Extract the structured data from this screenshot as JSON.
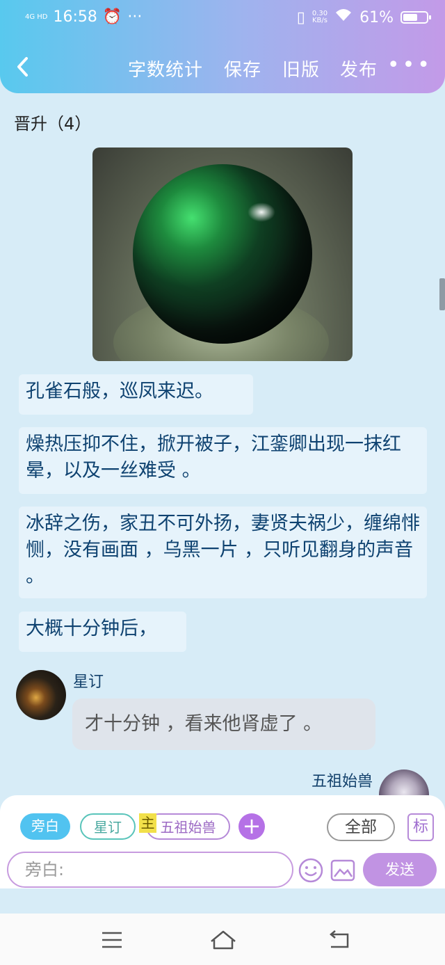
{
  "status_bar": {
    "network": "4G HD",
    "time": "16:58",
    "alarm_icon": "alarm-icon",
    "more_dots": "···",
    "speed_value": "0.30",
    "speed_unit": "KB/s",
    "battery": "61%"
  },
  "toolbar": {
    "back_icon": "chevron-left-icon",
    "word_count": "字数统计",
    "save": "保存",
    "old_version": "旧版",
    "publish": "发布",
    "more": "•••"
  },
  "chapter_title": "晋升（4）",
  "messages": [
    "孔雀石般，巡凤来迟。",
    "燥热压抑不住，掀开被子，江銮卿出现一抹红晕，以及一丝难受 。",
    "冰辞之伤，家丑不可外扬，妻贤夫祸少，缠绵悱恻，没有画面 ，乌黑一片 ，只听见翻身的声音 。",
    "大概十分钟后，"
  ],
  "chat": {
    "sender1": "星订",
    "reply1": "才十分钟 ，看来他肾虚了 。",
    "sender2": "五祖始兽"
  },
  "panel": {
    "chips": {
      "narrator": "旁白",
      "star": "星订",
      "main_mark": "主",
      "wuzu": "五祖始兽"
    },
    "plus": "+",
    "all": "全部",
    "mark_btn": "标",
    "input_placeholder": "旁白:",
    "send": "发送"
  },
  "colors": {
    "header_gradient_start": "#58c9ee",
    "header_gradient_end": "#c39ae8",
    "page_bg": "#d7ecf7",
    "bubble_bg": "#e6f3fb",
    "text_blue": "#0e4270",
    "send_bg": "#c193e3"
  }
}
